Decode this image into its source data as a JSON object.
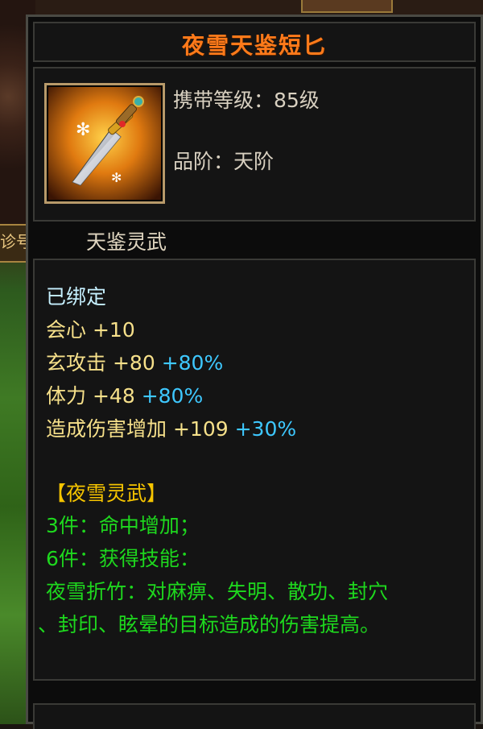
{
  "item": {
    "name": "夜雪天鉴短匕",
    "level_label": "携带等级：85级",
    "grade_label": "品阶：天阶",
    "set_series": "天鉴灵武",
    "icon": "dagger-icon"
  },
  "properties": {
    "bound": "已绑定",
    "stats": [
      {
        "label": "会心",
        "value": "+10",
        "pct": ""
      },
      {
        "label": "玄攻击",
        "value": "+80",
        "pct": "+80%"
      },
      {
        "label": "体力",
        "value": "+48",
        "pct": "+80%"
      },
      {
        "label": "造成伤害增加",
        "value": "+109",
        "pct": "+30%"
      }
    ]
  },
  "set_bonus": {
    "title": "【夜雪灵武】",
    "lines": [
      "3件：命中增加；",
      "6件：获得技能：",
      "夜雪折竹：对麻痹、失明、散功、封穴",
      "、封印、眩晕的目标造成的伤害提高。"
    ]
  },
  "left_tab_text": "诊号",
  "colors": {
    "name": "#ff7a1a",
    "bound": "#c6f0ff",
    "stat": "#f6e08a",
    "percent": "#3ec8ff",
    "set_title": "#f5c400",
    "set_text": "#1ed81e"
  }
}
